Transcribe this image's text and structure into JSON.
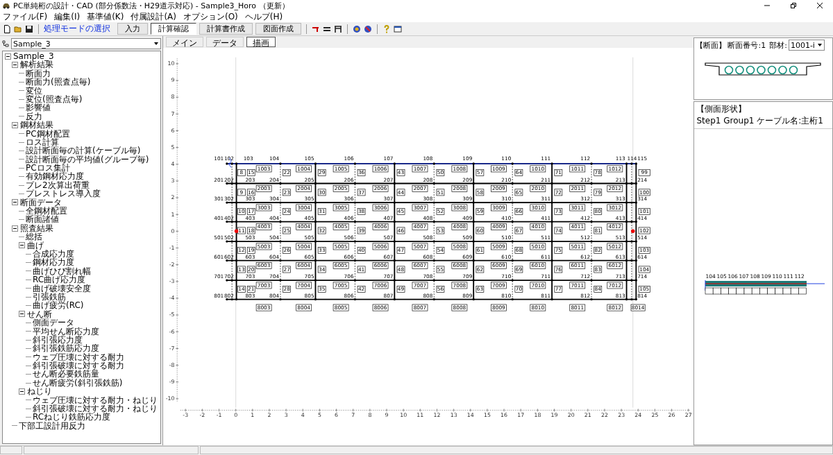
{
  "window": {
    "title": "PC単純桁の設計・CAD (部分係数法・H29道示対応) - Sample3_Horo （更新）"
  },
  "menu": [
    "ファイル(F)",
    "編集(I)",
    "基準値(K)",
    "付属設計(A)",
    "オプション(O)",
    "ヘルプ(H)"
  ],
  "toolbar": {
    "mode_label": "処理モードの選択",
    "modes": [
      {
        "label": "入力",
        "selected": false
      },
      {
        "label": "計算確認",
        "selected": true
      },
      {
        "label": "計算書作成",
        "selected": false
      },
      {
        "label": "図面作成",
        "selected": false
      }
    ]
  },
  "tree_selector": {
    "value": "Sample_3"
  },
  "view_tabs": [
    {
      "label": "メイン",
      "selected": false
    },
    {
      "label": "データ",
      "selected": false
    },
    {
      "label": "描画",
      "selected": true
    }
  ],
  "tree": [
    {
      "label": "Sample_3",
      "expanded": true,
      "children": [
        {
          "label": "解析結果",
          "expanded": true,
          "children": [
            {
              "label": "断面力"
            },
            {
              "label": "断面力(照査点毎)"
            },
            {
              "label": "変位"
            },
            {
              "label": "変位(照査点毎)"
            },
            {
              "label": "影響値"
            },
            {
              "label": "反力"
            }
          ]
        },
        {
          "label": "鋼材結果",
          "expanded": true,
          "children": [
            {
              "label": "PC鋼材配置"
            },
            {
              "label": "ロス計算"
            },
            {
              "label": "設計断面毎の計算(ケーブル毎)"
            },
            {
              "label": "設計断面毎の平均値(グループ毎)"
            },
            {
              "label": "PCロス集計"
            },
            {
              "label": "有効鋼材応力度"
            },
            {
              "label": "プレ2次算出荷重"
            },
            {
              "label": "プレストレス導入度"
            }
          ]
        },
        {
          "label": "断面データ",
          "expanded": true,
          "children": [
            {
              "label": "全鋼材配置"
            },
            {
              "label": "断面諸値"
            }
          ]
        },
        {
          "label": "照査結果",
          "expanded": true,
          "children": [
            {
              "label": "総括"
            },
            {
              "label": "曲げ",
              "expanded": true,
              "children": [
                {
                  "label": "合成応力度"
                },
                {
                  "label": "鋼材応力度"
                },
                {
                  "label": "曲げひび割れ幅"
                },
                {
                  "label": "RC曲げ応力度"
                },
                {
                  "label": "曲げ破壊安全度"
                },
                {
                  "label": "引張鉄筋"
                },
                {
                  "label": "曲げ疲労(RC)"
                }
              ]
            },
            {
              "label": "せん断",
              "expanded": true,
              "children": [
                {
                  "label": "側面データ"
                },
                {
                  "label": "平均せん断応力度"
                },
                {
                  "label": "斜引張応力度"
                },
                {
                  "label": "斜引張鉄筋応力度"
                },
                {
                  "label": "ウェブ圧壊に対する耐力"
                },
                {
                  "label": "斜引張破壊に対する耐力"
                },
                {
                  "label": "せん断必要鉄筋量"
                },
                {
                  "label": "せん断疲労(斜引張鉄筋)"
                }
              ]
            },
            {
              "label": "ねじり",
              "expanded": true,
              "children": [
                {
                  "label": "ウェブ圧壊に対する耐力・ねじり"
                },
                {
                  "label": "斜引張破壊に対する耐力・ねじり"
                },
                {
                  "label": "RCねじり鉄筋応力度"
                }
              ]
            }
          ]
        },
        {
          "label": "下部工設計用反力"
        }
      ]
    }
  ],
  "plot": {
    "x_ticks": [
      "-3",
      "-2",
      "-1",
      "0",
      "1",
      "2",
      "3",
      "4",
      "5",
      "6",
      "7",
      "8",
      "9",
      "10",
      "11",
      "12",
      "13",
      "14",
      "15",
      "16",
      "17",
      "18",
      "19",
      "20",
      "21",
      "22",
      "23",
      "24",
      "25",
      "26",
      "27"
    ],
    "y_ticks": [
      "10",
      "9",
      "8",
      "7",
      "6",
      "5",
      "4",
      "3",
      "2",
      "1",
      "0",
      "-1",
      "-2",
      "-3",
      "-4",
      "-5",
      "-6",
      "-7",
      "-8",
      "-9",
      "-10"
    ],
    "top_nodes": [
      "101",
      "102",
      "103",
      "104",
      "105",
      "106",
      "107",
      "108",
      "109",
      "110",
      "111",
      "112",
      "113",
      "114",
      "115"
    ],
    "rows": [
      {
        "members": [
          "1003",
          "1004",
          "1005",
          "1006",
          "1007",
          "1008",
          "1009",
          "1010",
          "1011",
          "1012"
        ],
        "ids": [
          "15",
          "22",
          "29",
          "36",
          "43",
          "50",
          "57",
          "64",
          "71",
          "78"
        ],
        "left_id": "8",
        "end_id": "99",
        "nodes": [
          "201",
          "202",
          "203",
          "204",
          "205",
          "206",
          "207",
          "208",
          "209",
          "210",
          "211",
          "212",
          "213",
          "214"
        ]
      },
      {
        "members": [
          "2003",
          "2004",
          "2005",
          "2006",
          "2007",
          "2008",
          "2009",
          "2010",
          "2011",
          "2012"
        ],
        "ids": [
          "16",
          "23",
          "30",
          "37",
          "44",
          "51",
          "58",
          "65",
          "72",
          "79"
        ],
        "left_id": "9",
        "end_id": "100",
        "nodes": [
          "301",
          "302",
          "303",
          "304",
          "305",
          "306",
          "307",
          "308",
          "309",
          "310",
          "311",
          "312",
          "313",
          "314"
        ]
      },
      {
        "members": [
          "3003",
          "3004",
          "3005",
          "3006",
          "3007",
          "3008",
          "3009",
          "3010",
          "3011",
          "3012"
        ],
        "ids": [
          "17",
          "24",
          "31",
          "38",
          "45",
          "52",
          "59",
          "66",
          "73",
          "80"
        ],
        "left_id": "10",
        "end_id": "101",
        "nodes": [
          "401",
          "402",
          "403",
          "404",
          "405",
          "406",
          "407",
          "408",
          "409",
          "410",
          "411",
          "412",
          "413",
          "414"
        ]
      },
      {
        "members": [
          "4003",
          "4004",
          "4005",
          "4006",
          "4007",
          "4008",
          "4009",
          "4010",
          "4011",
          "4012"
        ],
        "ids": [
          "18",
          "25",
          "32",
          "39",
          "46",
          "53",
          "60",
          "67",
          "74",
          "81"
        ],
        "left_id": "11",
        "end_id": "102",
        "nodes": [
          "501",
          "502",
          "503",
          "504",
          "505",
          "506",
          "507",
          "508",
          "509",
          "510",
          "511",
          "512",
          "513",
          "514"
        ]
      },
      {
        "members": [
          "5003",
          "5004",
          "5005",
          "5006",
          "5007",
          "5008",
          "5009",
          "5010",
          "5011",
          "5012"
        ],
        "ids": [
          "19",
          "26",
          "33",
          "40",
          "47",
          "54",
          "61",
          "68",
          "75",
          "82"
        ],
        "left_id": "12",
        "end_id": "103",
        "nodes": [
          "601",
          "602",
          "603",
          "604",
          "605",
          "606",
          "607",
          "608",
          "609",
          "610",
          "611",
          "612",
          "613",
          "614"
        ]
      },
      {
        "members": [
          "6003",
          "6004",
          "6005",
          "6006",
          "6007",
          "6008",
          "6009",
          "6010",
          "6011",
          "6012"
        ],
        "ids": [
          "20",
          "27",
          "34",
          "41",
          "48",
          "55",
          "62",
          "69",
          "76",
          "83"
        ],
        "left_id": "13",
        "end_id": "104",
        "nodes": [
          "701",
          "702",
          "703",
          "704",
          "705",
          "706",
          "707",
          "708",
          "709",
          "710",
          "711",
          "712",
          "713",
          "714"
        ]
      },
      {
        "members": [
          "7003",
          "7004",
          "7005",
          "7006",
          "7007",
          "7008",
          "7009",
          "7010",
          "7011",
          "7012"
        ],
        "ids": [
          "21",
          "28",
          "35",
          "42",
          "49",
          "56",
          "63",
          "70",
          "77",
          "84"
        ],
        "left_id": "14",
        "end_id": "105",
        "nodes": [
          "801",
          "802",
          "803",
          "804",
          "805",
          "806",
          "807",
          "808",
          "809",
          "810",
          "811",
          "812",
          "813",
          "814"
        ]
      }
    ],
    "bottom_members": [
      "8003",
      "8004",
      "8005",
      "8006",
      "8007",
      "8008",
      "8009",
      "8010",
      "8011",
      "8012"
    ],
    "bottom_end": "8014"
  },
  "section": {
    "title": "【断面】",
    "number_label": "断面番号:",
    "number": "1",
    "member_label": "部材:",
    "member": "1001-i"
  },
  "side": {
    "title": "【側面形状】",
    "info": "Step1 Group1 ケーブル名:主桁1",
    "nodes": [
      "104",
      "105",
      "106",
      "107",
      "108",
      "109",
      "110",
      "111",
      "112"
    ]
  }
}
